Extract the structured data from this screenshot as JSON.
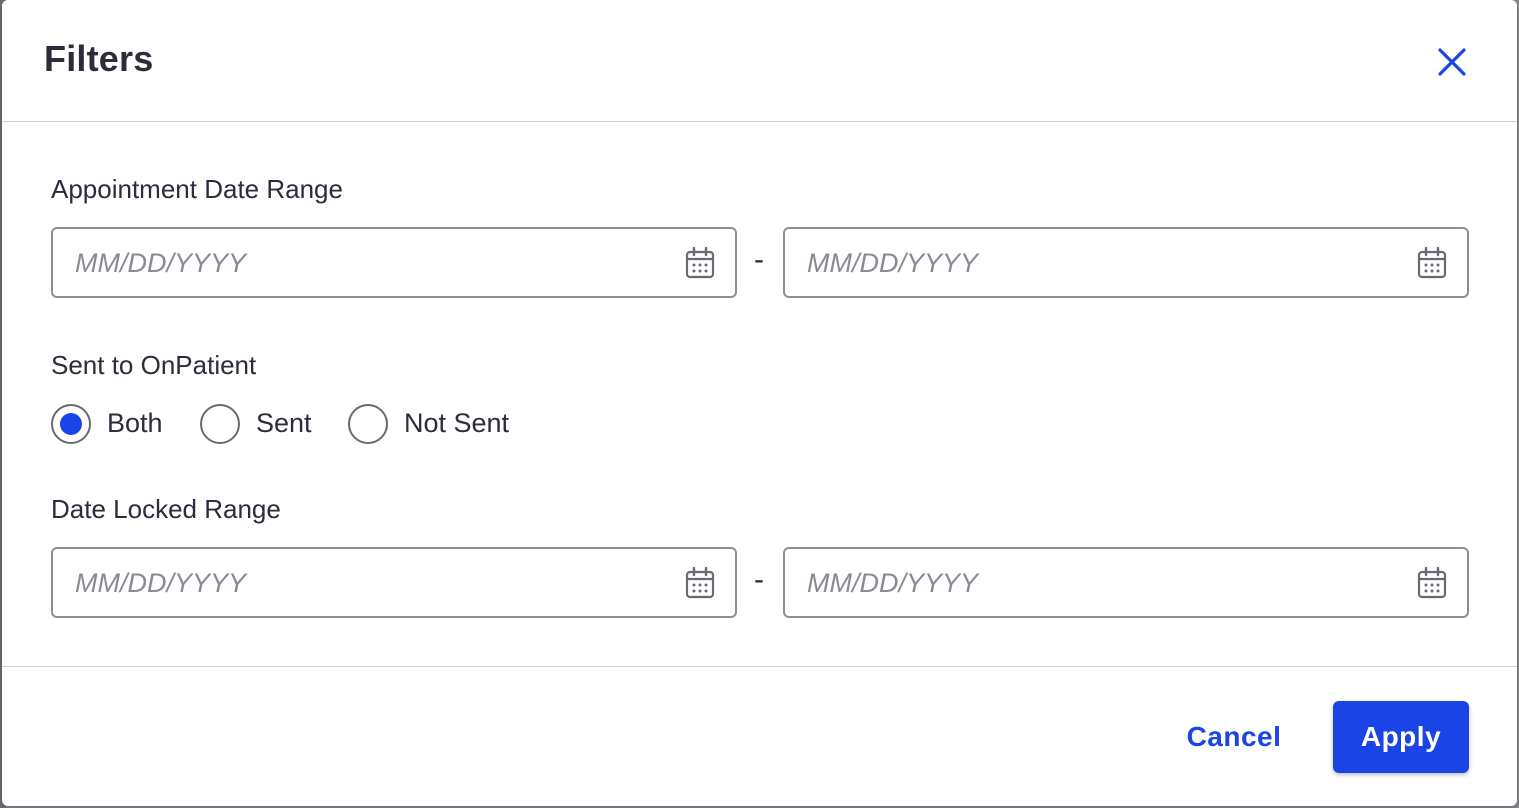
{
  "modal": {
    "title": "Filters"
  },
  "appointment_range": {
    "label": "Appointment Date Range",
    "start_placeholder": "MM/DD/YYYY",
    "start_value": "",
    "end_placeholder": "MM/DD/YYYY",
    "end_value": "",
    "separator": "-"
  },
  "sent_to": {
    "label": "Sent to OnPatient",
    "options": [
      {
        "label": "Both",
        "checked": true
      },
      {
        "label": "Sent",
        "checked": false
      },
      {
        "label": "Not Sent",
        "checked": false
      }
    ],
    "selected": "Both"
  },
  "locked_range": {
    "label": "Date Locked Range",
    "start_placeholder": "MM/DD/YYYY",
    "start_value": "",
    "end_placeholder": "MM/DD/YYYY",
    "end_value": "",
    "separator": "-"
  },
  "footer": {
    "cancel_label": "Cancel",
    "apply_label": "Apply"
  },
  "icons": {
    "close": "close-icon",
    "calendar": "calendar-icon"
  },
  "colors": {
    "accent": "#1a44e6",
    "text": "#2c2c3a",
    "placeholder": "#8a8a94",
    "border": "#8e8e98"
  }
}
